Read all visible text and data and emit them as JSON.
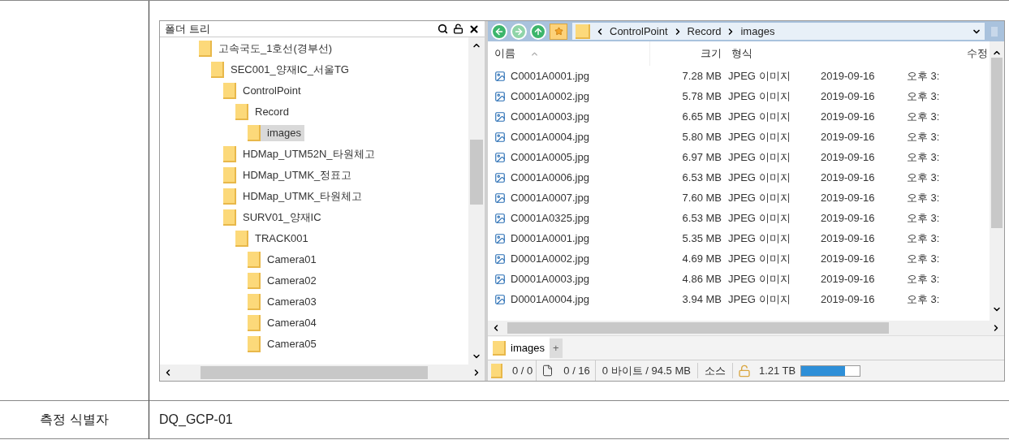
{
  "folder_panel": {
    "title": "폴더 트리",
    "tree": [
      {
        "label": "고속국도_1호선(경부선)",
        "selected": false,
        "children": [
          {
            "label": "SEC001_양재IC_서울TG",
            "selected": false,
            "children": [
              {
                "label": "ControlPoint",
                "selected": false,
                "children": [
                  {
                    "label": "Record",
                    "selected": false,
                    "children": [
                      {
                        "label": "images",
                        "selected": true
                      }
                    ]
                  }
                ]
              },
              {
                "label": "HDMap_UTM52N_타원체고",
                "selected": false
              },
              {
                "label": "HDMap_UTMK_정표고",
                "selected": false
              },
              {
                "label": "HDMap_UTMK_타원체고",
                "selected": false
              },
              {
                "label": "SURV01_양재IC",
                "selected": false,
                "children": [
                  {
                    "label": "TRACK001",
                    "selected": false,
                    "children": [
                      {
                        "label": "Camera01",
                        "selected": false
                      },
                      {
                        "label": "Camera02",
                        "selected": false
                      },
                      {
                        "label": "Camera03",
                        "selected": false
                      },
                      {
                        "label": "Camera04",
                        "selected": false
                      },
                      {
                        "label": "Camera05",
                        "selected": false
                      }
                    ]
                  }
                ]
              }
            ]
          }
        ]
      }
    ]
  },
  "file_panel": {
    "breadcrumb": [
      "ControlPoint",
      "Record",
      "images"
    ],
    "columns": [
      "이름",
      "크기",
      "형식",
      "수정"
    ],
    "rows": [
      {
        "name": "C0001A0001.jpg",
        "size": "7.28 MB",
        "type": "JPEG 이미지",
        "date": "2019-09-16",
        "time": "오후 3:"
      },
      {
        "name": "C0001A0002.jpg",
        "size": "5.78 MB",
        "type": "JPEG 이미지",
        "date": "2019-09-16",
        "time": "오후 3:"
      },
      {
        "name": "C0001A0003.jpg",
        "size": "6.65 MB",
        "type": "JPEG 이미지",
        "date": "2019-09-16",
        "time": "오후 3:"
      },
      {
        "name": "C0001A0004.jpg",
        "size": "5.80 MB",
        "type": "JPEG 이미지",
        "date": "2019-09-16",
        "time": "오후 3:"
      },
      {
        "name": "C0001A0005.jpg",
        "size": "6.97 MB",
        "type": "JPEG 이미지",
        "date": "2019-09-16",
        "time": "오후 3:"
      },
      {
        "name": "C0001A0006.jpg",
        "size": "6.53 MB",
        "type": "JPEG 이미지",
        "date": "2019-09-16",
        "time": "오후 3:"
      },
      {
        "name": "C0001A0007.jpg",
        "size": "7.60 MB",
        "type": "JPEG 이미지",
        "date": "2019-09-16",
        "time": "오후 3:"
      },
      {
        "name": "C0001A0325.jpg",
        "size": "6.53 MB",
        "type": "JPEG 이미지",
        "date": "2019-09-16",
        "time": "오후 3:"
      },
      {
        "name": "D0001A0001.jpg",
        "size": "5.35 MB",
        "type": "JPEG 이미지",
        "date": "2019-09-16",
        "time": "오후 3:"
      },
      {
        "name": "D0001A0002.jpg",
        "size": "4.69 MB",
        "type": "JPEG 이미지",
        "date": "2019-09-16",
        "time": "오후 3:"
      },
      {
        "name": "D0001A0003.jpg",
        "size": "4.86 MB",
        "type": "JPEG 이미지",
        "date": "2019-09-16",
        "time": "오후 3:"
      },
      {
        "name": "D0001A0004.jpg",
        "size": "3.94 MB",
        "type": "JPEG 이미지",
        "date": "2019-09-16",
        "time": "오후 3:"
      }
    ],
    "tabs": [
      {
        "label": "images",
        "selected": true
      }
    ],
    "add_tab": "+",
    "status_bar": {
      "folders": "0 / 0",
      "files": "0 / 16",
      "bytes": "0 바이트 / 94.5 MB",
      "source": "소스",
      "free_space": "1.21 TB",
      "level": 0.75
    }
  },
  "table": {
    "label": "측정 식별자",
    "value": "DQ_GCP-01"
  }
}
